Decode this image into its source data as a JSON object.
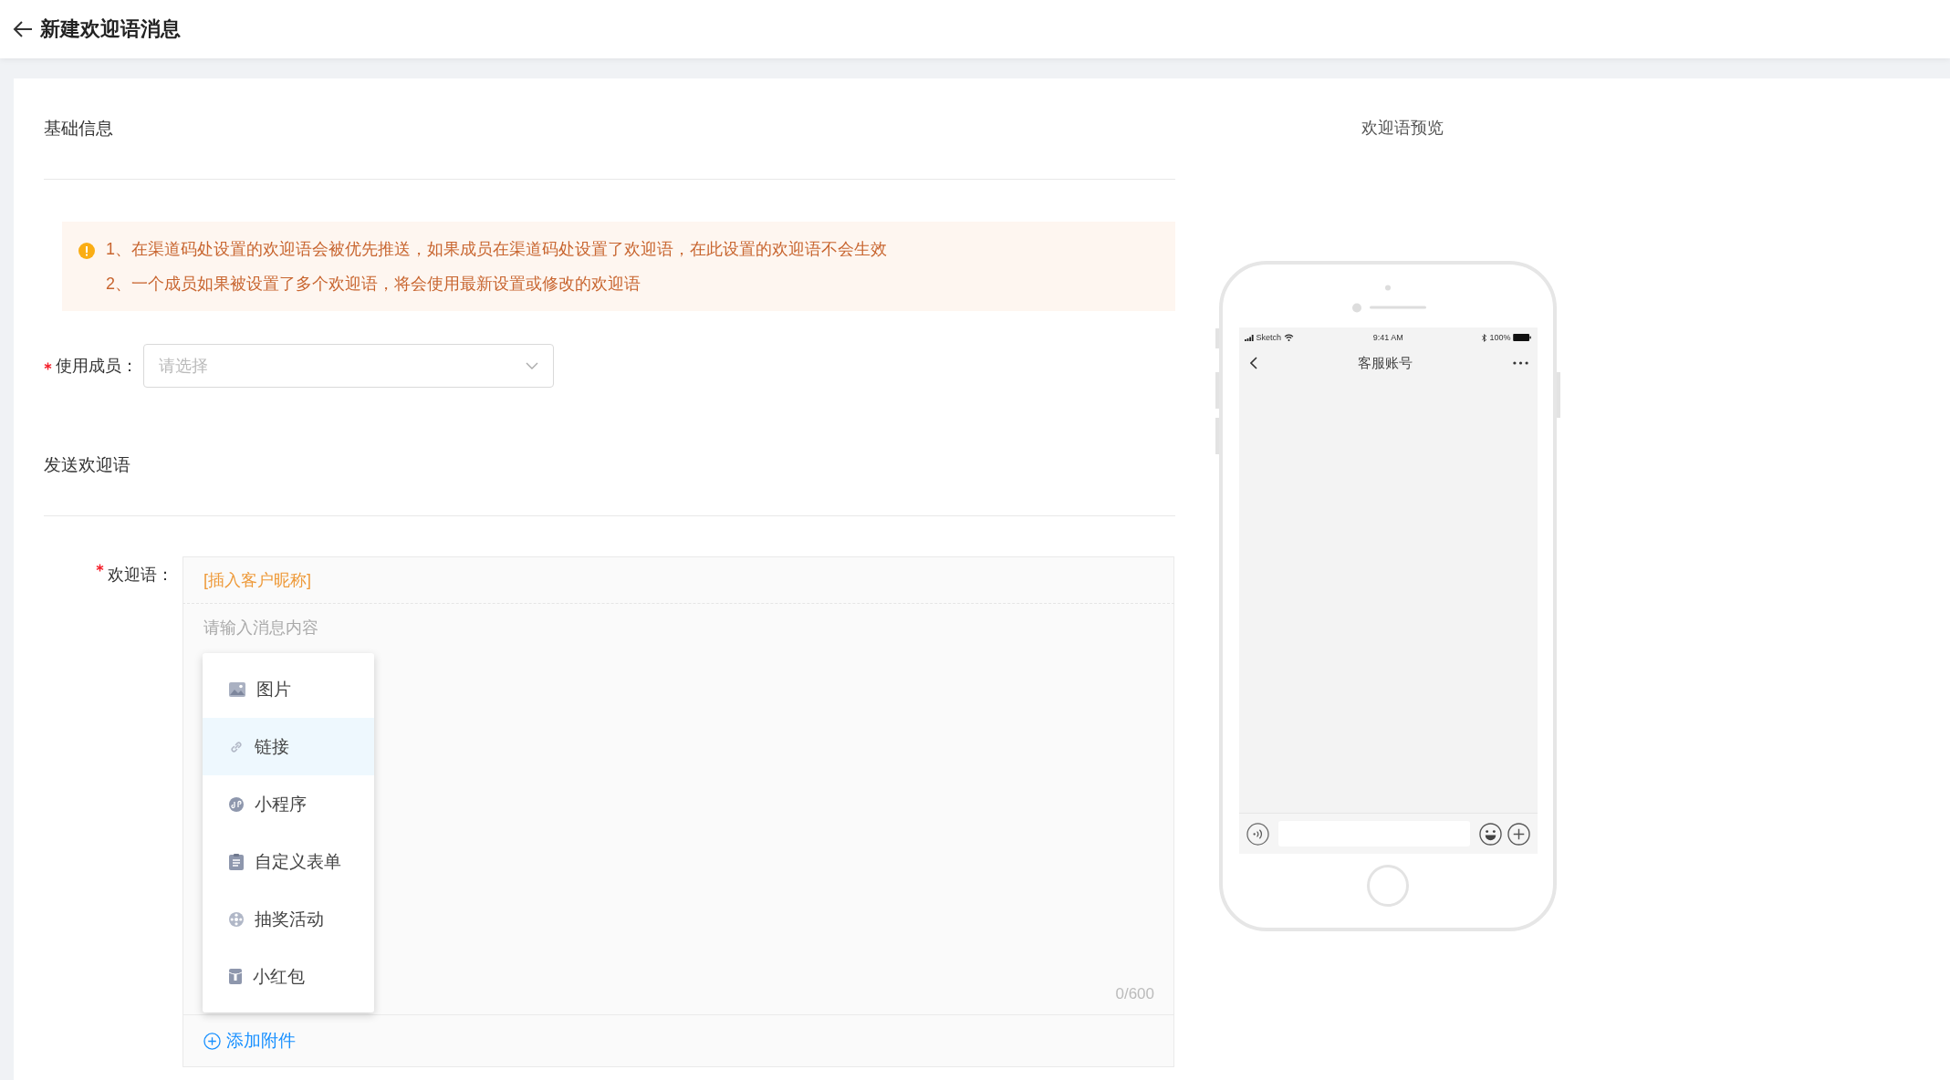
{
  "header": {
    "title": "新建欢迎语消息"
  },
  "basic_section": {
    "title": "基础信息"
  },
  "notice": {
    "lines": [
      "1、在渠道码处设置的欢迎语会被优先推送，如果成员在渠道码处设置了欢迎语，在此设置的欢迎语不会生效",
      "2、一个成员如果被设置了多个欢迎语，将会使用最新设置或修改的欢迎语"
    ]
  },
  "member_field": {
    "label": "使用成员：",
    "required": true,
    "placeholder": "请选择"
  },
  "send_section": {
    "title": "发送欢迎语"
  },
  "welcome_field": {
    "label": "欢迎语：",
    "required": true,
    "insert_link": "[插入客户昵称]",
    "placeholder": "请输入消息内容",
    "counter": "0/600",
    "add_attachment": "添加附件",
    "attachment_menu": [
      {
        "kind": "image",
        "label": "图片",
        "selected": false
      },
      {
        "kind": "link",
        "label": "链接",
        "selected": true
      },
      {
        "kind": "miniprogram",
        "label": "小程序",
        "selected": false
      },
      {
        "kind": "form",
        "label": "自定义表单",
        "selected": false
      },
      {
        "kind": "lottery",
        "label": "抽奖活动",
        "selected": false
      },
      {
        "kind": "redpacket",
        "label": "小红包",
        "selected": false
      }
    ]
  },
  "preview": {
    "title": "欢迎语预览",
    "carrier": "Sketch",
    "time": "9:41 AM",
    "battery": "100%",
    "nav_title": "客服账号"
  }
}
